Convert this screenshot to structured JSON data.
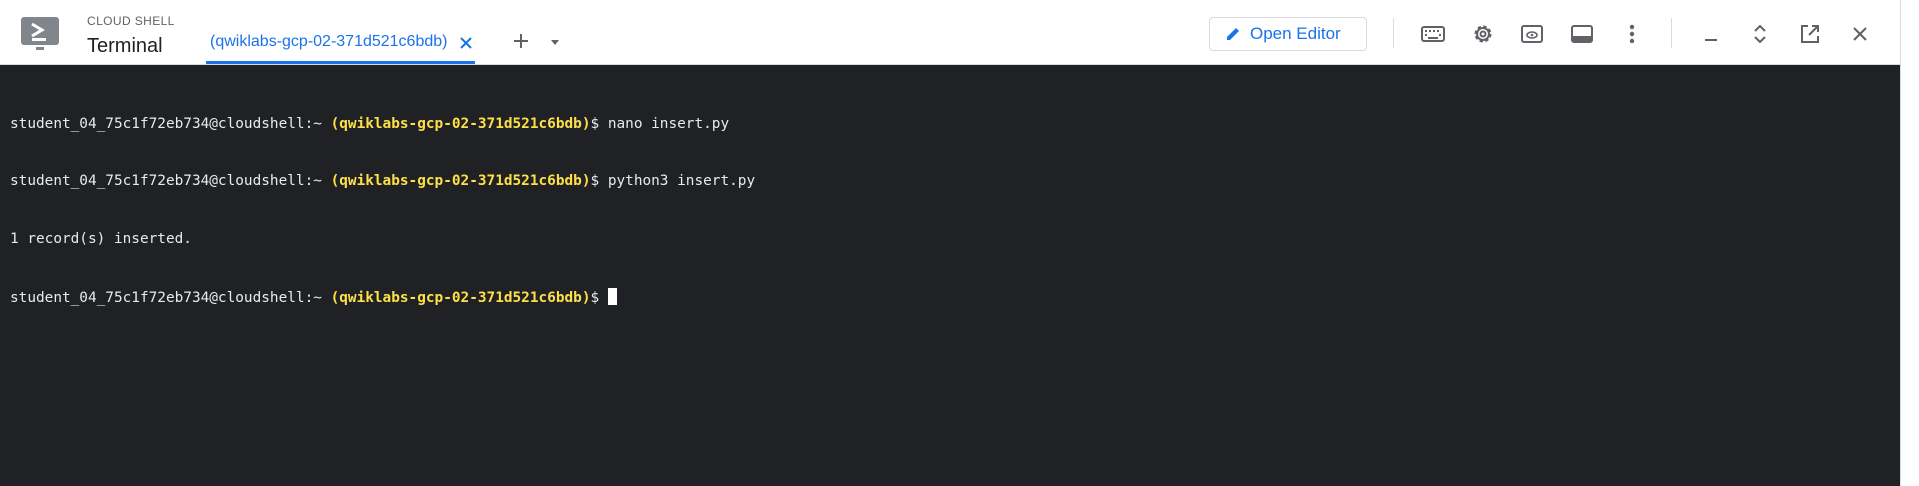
{
  "header": {
    "caption": "CLOUD SHELL",
    "title": "Terminal",
    "tab": {
      "label": "(qwiklabs-gcp-02-371d521c6bdb)"
    },
    "open_editor_label": "Open Editor"
  },
  "icons": {
    "logo": "cloud-shell-icon",
    "tab_close": "close-icon",
    "add_tab": "plus-icon",
    "tab_menu": "caret-down-icon",
    "editor": "pencil-icon",
    "keyboard": "keyboard-icon",
    "settings": "gear-icon",
    "web_preview": "web-preview-icon",
    "layout": "panel-icon",
    "more": "more-vert-icon",
    "minimize": "minimize-icon",
    "maximize": "unfold-icon",
    "popout": "open-in-new-icon",
    "close": "close-icon"
  },
  "colors": {
    "accent": "#1a73e8",
    "terminal_bg": "#202124",
    "terminal_text": "#e8eaed",
    "project_text": "#fde047"
  },
  "terminal": {
    "lines": [
      {
        "user": "student_04_75c1f72eb734@cloudshell:~",
        "project": "(qwiklabs-gcp-02-371d521c6bdb)",
        "command": "$ nano insert.py"
      },
      {
        "user": "student_04_75c1f72eb734@cloudshell:~",
        "project": "(qwiklabs-gcp-02-371d521c6bdb)",
        "command": "$ python3 insert.py"
      },
      {
        "output": "1 record(s) inserted."
      },
      {
        "user": "student_04_75c1f72eb734@cloudshell:~",
        "project": "(qwiklabs-gcp-02-371d521c6bdb)",
        "command": "$ "
      }
    ]
  }
}
